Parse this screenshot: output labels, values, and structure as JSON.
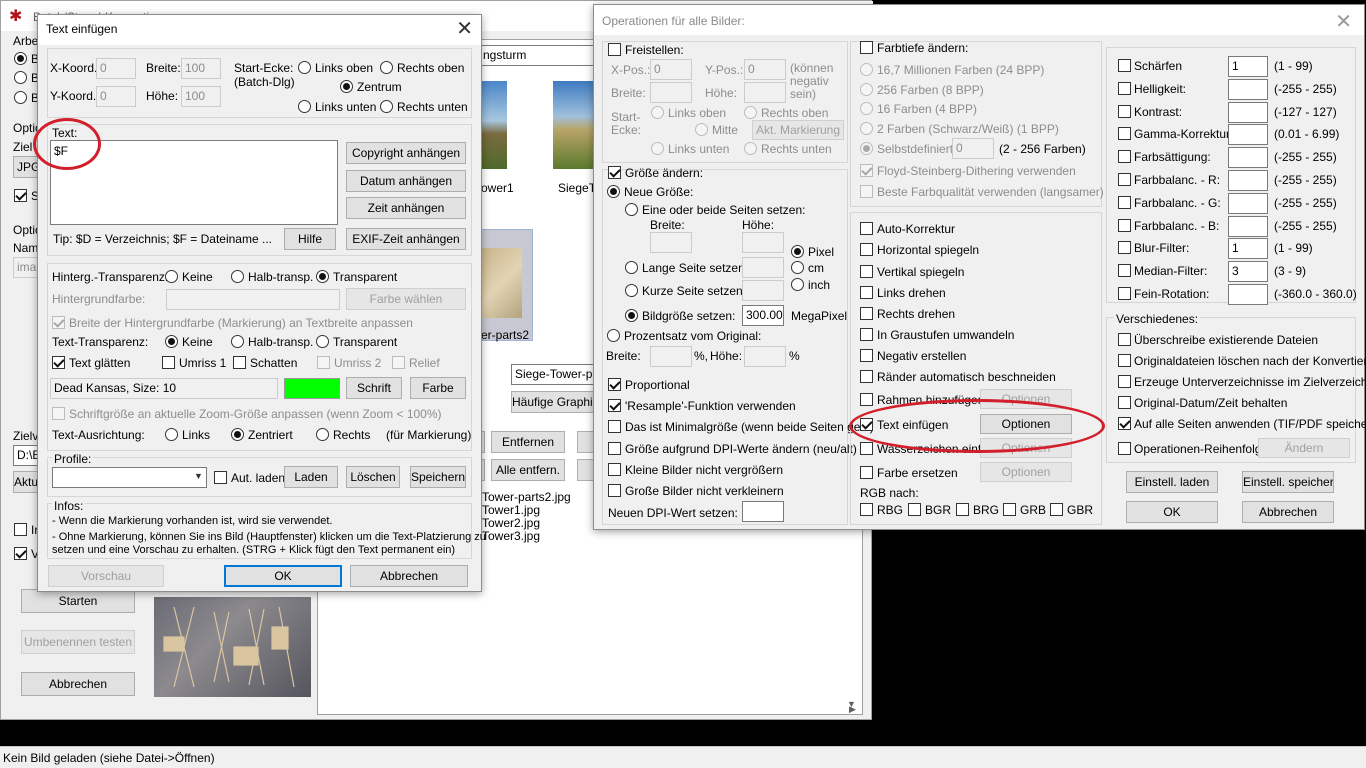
{
  "bg": {
    "main_title": "Batch/Stapel-Konvertierung",
    "status_bar": "Kein Bild geladen (siehe Datei->Öffnen)",
    "path_field": "ngsturm",
    "thumb_names": [
      "ower1",
      "SiegeT",
      "er-parts2"
    ],
    "file_list": [
      "Tower-parts2.jpg",
      "Tower1.jpg",
      "Tower2.jpg",
      "Tower3.jpg"
    ],
    "combo1": "Siege-Tower-par",
    "btn_haeufig": "Häufige Graphik",
    "btn_entfernen": "Entfernen",
    "btn_alle_entf": "Alle entfern.",
    "left_labels": [
      "Arbe",
      "B",
      "B",
      "B",
      "Optio",
      "Ziel",
      "JPG",
      "S",
      "Optio",
      "Nam",
      "imag",
      "Zielv",
      "D:\\E",
      "Aktu",
      "In",
      "V"
    ],
    "btn_starten": "Starten",
    "btn_umbenennen": "Umbenennen testen",
    "btn_abbrechen": "Abbrechen"
  },
  "text_dialog": {
    "title": "Text einfügen",
    "x_label": "X-Koord.:",
    "x_value": "0",
    "breite_label": "Breite:",
    "breite_value": "100",
    "y_label": "Y-Koord.:",
    "y_value": "0",
    "hoehe_label": "Höhe:",
    "hoehe_value": "100",
    "start_ecke_label": "Start-Ecke:",
    "start_ecke_sub": "(Batch-Dlg)",
    "pos_links_oben": "Links oben",
    "pos_rechts_oben": "Rechts oben",
    "pos_zentrum": "Zentrum",
    "pos_links_unten": "Links unten",
    "pos_rechts_unten": "Rechts unten",
    "text_label": "Text:",
    "text_value": "$F",
    "btn_copyright": "Copyright anhängen",
    "btn_datum": "Datum anhängen",
    "btn_zeit": "Zeit anhängen",
    "btn_exif": "EXIF-Zeit anhängen",
    "btn_hilfe": "Hilfe",
    "tip": "Tip: $D = Verzeichnis; $F = Dateiname ...",
    "hinterg_label": "Hinterg.-Transparenz:",
    "opt_keine": "Keine",
    "opt_halb": "Halb-transp.",
    "opt_transparent": "Transparent",
    "hintergrundfarbe_label": "Hintergrundfarbe:",
    "btn_farbe_waehlen": "Farbe wählen",
    "breite_anpassen": "Breite der Hintergrundfarbe (Markierung) an Textbreite anpassen",
    "text_transp_label": "Text-Transparenz:",
    "text_glaetten": "Text glätten",
    "umriss1": "Umriss 1",
    "schatten": "Schatten",
    "umriss2": "Umriss 2",
    "relief": "Relief",
    "font_field": "Dead Kansas, Size: 10",
    "font_color": "#00ff00",
    "btn_schrift": "Schrift",
    "btn_farbe": "Farbe",
    "zoom_anpassen": "Schriftgröße an aktuelle Zoom-Größe anpassen (wenn Zoom < 100%)",
    "ausrichtung_label": "Text-Ausrichtung:",
    "opt_links": "Links",
    "opt_zentriert": "Zentriert",
    "opt_rechts": "Rechts",
    "fuer_markierung": "(für Markierung)",
    "profile_label": "Profile:",
    "profile_value": "",
    "aut_laden": "Aut. laden",
    "btn_laden": "Laden",
    "btn_loeschen": "Löschen",
    "btn_speichern": "Speichern",
    "infos_label": "Infos:",
    "info1": "- Wenn die Markierung vorhanden ist, wird sie verwendet.",
    "info2": "- Ohne Markierung, können Sie ins Bild (Hauptfenster) klicken um die Text-Platzierung zu",
    "info3": "setzen und eine Vorschau zu erhalten. (STRG + Klick fügt den Text permanent ein)",
    "btn_vorschau": "Vorschau",
    "btn_ok": "OK",
    "btn_abbrechen": "Abbrechen"
  },
  "ops_dialog": {
    "title": "Operationen für alle Bilder:",
    "freistellen": "Freistellen:",
    "xpos_label": "X-Pos.:",
    "xpos_value": "0",
    "ypos_label": "Y-Pos.:",
    "ypos_value": "0",
    "koennen_negativ": "(können negativ sein)",
    "breite_label": "Breite:",
    "hoehe_label": "Höhe:",
    "start_ecke": "Start-Ecke:",
    "links_oben": "Links oben",
    "rechts_oben": "Rechts oben",
    "mitte": "Mitte",
    "akt_markierung": "Akt. Markierung",
    "links_unten": "Links unten",
    "rechts_unten": "Rechts unten",
    "groesse_aendern": "Größe ändern:",
    "neue_groesse": "Neue Größe:",
    "eine_oder_beide": "Eine oder beide Seiten setzen:",
    "breite_sub": "Breite:",
    "hoehe_sub": "Höhe:",
    "pixel": "Pixel",
    "cm": "cm",
    "inch": "inch",
    "lange_seite": "Lange Seite setzen:",
    "kurze_seite": "Kurze Seite setzen:",
    "bildgroesse": "Bildgröße setzen:",
    "bildgroesse_value": "300.00",
    "megapixel": "MegaPixel",
    "prozentsatz": "Prozentsatz vom Original:",
    "breite_pct": "Breite:",
    "pct": "%,",
    "hoehe_pct": "Höhe:",
    "pct2": "%",
    "proportional": "Proportional",
    "resample": "'Resample'-Funktion verwenden",
    "minimalgroesse": "Das ist Minimalgröße (wenn beide Seiten ges.)",
    "dpi_aendern": "Größe aufgrund DPI-Werte ändern (neu/alt)",
    "kleine_bilder": "Kleine Bilder nicht vergrößern",
    "grosse_bilder": "Große Bilder nicht verkleinern",
    "neuen_dpi": "Neuen DPI-Wert setzen:",
    "farbtiefe": "Farbtiefe ändern:",
    "ft_16m": "16,7 Millionen Farben (24 BPP)",
    "ft_256": "256 Farben (8 BPP)",
    "ft_16": "16 Farben (4 BPP)",
    "ft_2": "2 Farben (Schwarz/Weiß) (1 BPP)",
    "ft_selbst": "Selbstdefiniert:",
    "ft_selbst_value": "0",
    "ft_range": "(2 - 256 Farben)",
    "floyd": "Floyd-Steinberg-Dithering verwenden",
    "beste_farb": "Beste Farbqualität verwenden (langsamer)",
    "auto_korrektur": "Auto-Korrektur",
    "horizontal": "Horizontal spiegeln",
    "vertikal": "Vertikal spiegeln",
    "links_drehen": "Links drehen",
    "rechts_drehen": "Rechts drehen",
    "graustufen": "In Graustufen umwandeln",
    "negativ": "Negativ erstellen",
    "raender": "Ränder automatisch beschneiden",
    "rahmen": "Rahmen hinzufügen",
    "text_einfuegen": "Text einfügen",
    "wasserzeichen": "Wasserzeichen einf.",
    "farbe_ersetzen": "Farbe ersetzen",
    "btn_optionen": "Optionen",
    "rgb_nach": "RGB nach:",
    "rgb": [
      "RBG",
      "BGR",
      "BRG",
      "GRB",
      "GBR"
    ],
    "adjustments": [
      {
        "label": "Schärfen",
        "value": "1",
        "range": "(1  -  99)"
      },
      {
        "label": "Helligkeit:",
        "value": "",
        "range": "(-255  -  255)"
      },
      {
        "label": "Kontrast:",
        "value": "",
        "range": "(-127  -  127)"
      },
      {
        "label": "Gamma-Korrektur:",
        "value": "",
        "range": "(0.01  -  6.99)"
      },
      {
        "label": "Farbsättigung:",
        "value": "",
        "range": "(-255  -  255)"
      },
      {
        "label": "Farbbalanc. - R:",
        "value": "",
        "range": "(-255  -  255)"
      },
      {
        "label": "Farbbalanc. - G:",
        "value": "",
        "range": "(-255  -  255)"
      },
      {
        "label": "Farbbalanc. - B:",
        "value": "",
        "range": "(-255  -  255)"
      },
      {
        "label": "Blur-Filter:",
        "value": "1",
        "range": "(1  -  99)"
      },
      {
        "label": "Median-Filter:",
        "value": "3",
        "range": "(3  -  9)"
      },
      {
        "label": "Fein-Rotation:",
        "value": "",
        "range": "(-360.0  -  360.0)"
      }
    ],
    "verschiedenes": "Verschiedenes:",
    "ueberschreibe": "Überschreibe existierende Dateien",
    "original_loeschen": "Originaldateien löschen nach der Konvertier.",
    "unterverzeichnisse": "Erzeuge Unterverzeichnisse im Zielverzeichn.",
    "original_datum": "Original-Datum/Zeit behalten",
    "alle_seiten": "Auf alle Seiten anwenden (TIF/PDF speichern)",
    "reihenfolge": "Operationen-Reihenfolge",
    "btn_aendern": "Ändern",
    "btn_einstell_laden": "Einstell. laden",
    "btn_einstell_speichern": "Einstell. speichern",
    "btn_ok": "OK",
    "btn_abbrechen": "Abbrechen"
  }
}
